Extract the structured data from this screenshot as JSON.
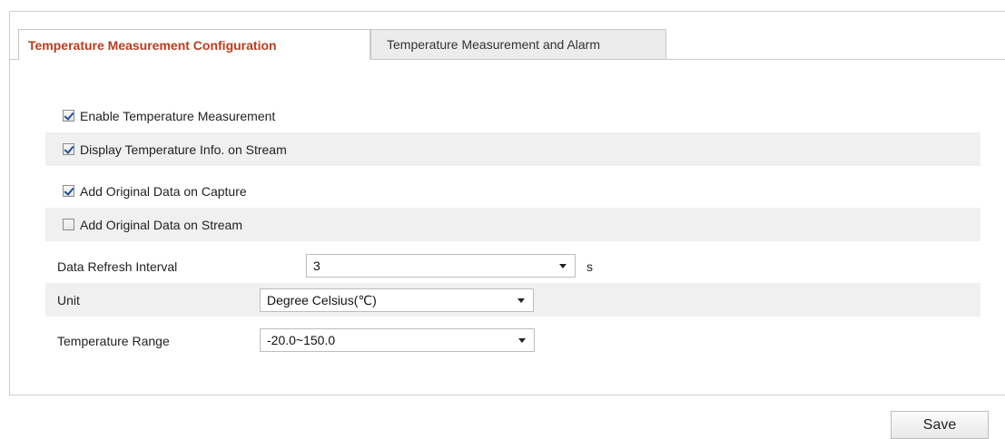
{
  "tabs": [
    {
      "label": "Temperature Measurement Configuration",
      "active": true
    },
    {
      "label": "Temperature Measurement and Alarm",
      "active": false
    }
  ],
  "checkboxes": [
    {
      "label": "Enable Temperature Measurement",
      "checked": true
    },
    {
      "label": "Display Temperature Info. on Stream",
      "checked": true
    },
    {
      "label": "Add Original Data on Capture",
      "checked": true
    },
    {
      "label": "Add Original Data on Stream",
      "checked": false
    }
  ],
  "fields": {
    "refresh": {
      "label": "Data Refresh Interval",
      "value": "3",
      "unit": "s"
    },
    "unit": {
      "label": "Unit",
      "value": "Degree Celsius(℃)"
    },
    "range": {
      "label": "Temperature Range",
      "value": "-20.0~150.0"
    }
  },
  "save_label": "Save",
  "colors": {
    "active_tab_text": "#b63d1e",
    "check_mark": "#1f4e9d",
    "row_shade": "#f0f0f0"
  }
}
